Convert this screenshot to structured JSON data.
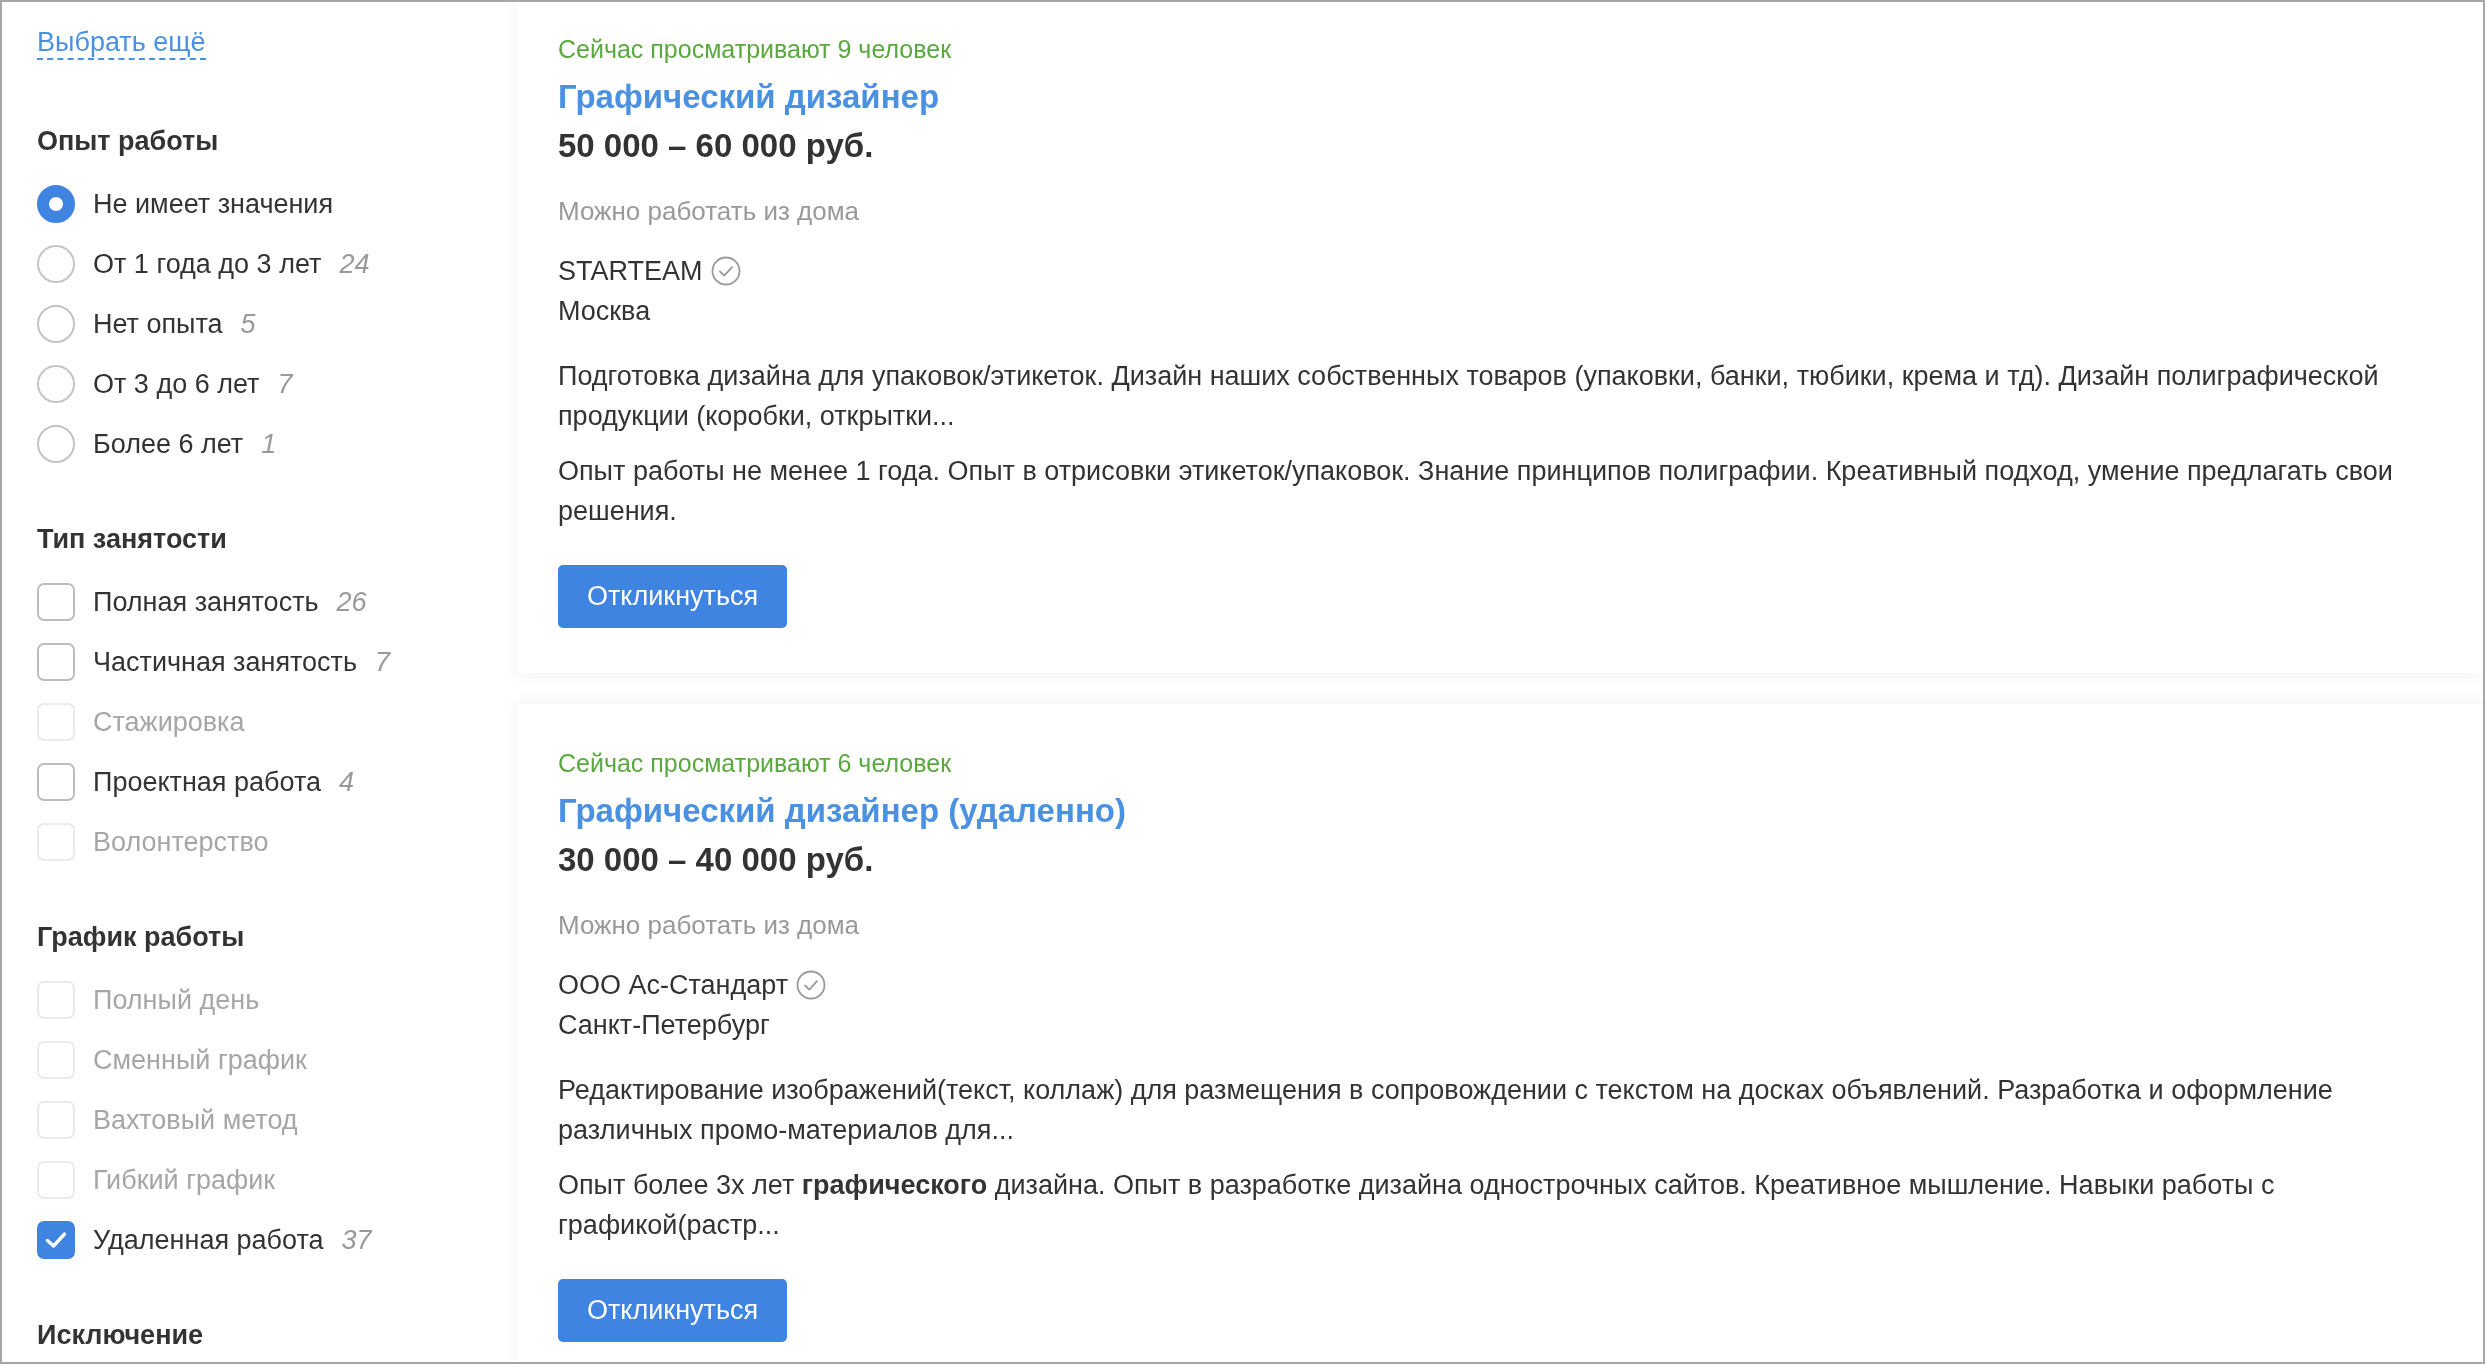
{
  "sidebar": {
    "more_link": "Выбрать ещё",
    "filter_groups": [
      {
        "title": "Опыт работы",
        "kind": "radio",
        "options": [
          {
            "label": "Не имеет значения",
            "selected": true
          },
          {
            "label": "От 1 года до 3 лет",
            "count": "24",
            "selected": false
          },
          {
            "label": "Нет опыта",
            "count": "5",
            "selected": false
          },
          {
            "label": "От 3 до 6 лет",
            "count": "7",
            "selected": false
          },
          {
            "label": "Более 6 лет",
            "count": "1",
            "selected": false
          }
        ]
      },
      {
        "title": "Тип занятости",
        "kind": "checkbox",
        "options": [
          {
            "label": "Полная занятость",
            "count": "26",
            "checked": false,
            "disabled": false
          },
          {
            "label": "Частичная занятость",
            "count": "7",
            "checked": false,
            "disabled": false
          },
          {
            "label": "Стажировка",
            "checked": false,
            "disabled": true
          },
          {
            "label": "Проектная работа",
            "count": "4",
            "checked": false,
            "disabled": false
          },
          {
            "label": "Волонтерство",
            "checked": false,
            "disabled": true
          }
        ]
      },
      {
        "title": "График работы",
        "kind": "checkbox",
        "options": [
          {
            "label": "Полный день",
            "checked": false,
            "disabled": true
          },
          {
            "label": "Сменный график",
            "checked": false,
            "disabled": true
          },
          {
            "label": "Вахтовый метод",
            "checked": false,
            "disabled": true
          },
          {
            "label": "Гибкий график",
            "checked": false,
            "disabled": true
          },
          {
            "label": "Удаленная работа",
            "count": "37",
            "checked": true,
            "disabled": false
          }
        ]
      },
      {
        "title": "Исключение"
      }
    ]
  },
  "vacancies": [
    {
      "viewers": "Сейчас просматривают 9 человек",
      "title": "Графический дизайнер",
      "salary": "50 000 – 60 000 руб.",
      "remote_note": "Можно работать из дома",
      "company": "STARTEAM",
      "verified": true,
      "city": "Москва",
      "description": "Подготовка дизайна для упаковок/этикеток. Дизайн наших собственных товаров (упаковки, банки, тюбики, крема и тд). Дизайн полиграфической продукции (коробки, открытки...",
      "requirements": "Опыт работы не менее 1 года. Опыт в отрисовки этикеток/упаковок. Знание принципов полиграфии. Креативный подход, умение предлагать свои решения.",
      "button": "Откликнуться"
    },
    {
      "viewers": "Сейчас просматривают 6 человек",
      "title": "Графический дизайнер (удаленно)",
      "salary": "30 000 – 40 000 руб.",
      "remote_note": "Можно работать из дома",
      "company": "ООО Ас-Стандарт",
      "verified": true,
      "city": "Санкт-Петербург",
      "description": "Редактирование изображений(текст, коллаж) для размещения в сопровождении с текстом на досках объявлений. Разработка и оформление различных промо-материалов для...",
      "requirements": "Опыт более 3х лет **графического** дизайна. Опыт в разработке дизайна однострочных сайтов. Креативное мышление. Навыки работы с графикой(растр...",
      "button": "Откликнуться"
    }
  ]
}
